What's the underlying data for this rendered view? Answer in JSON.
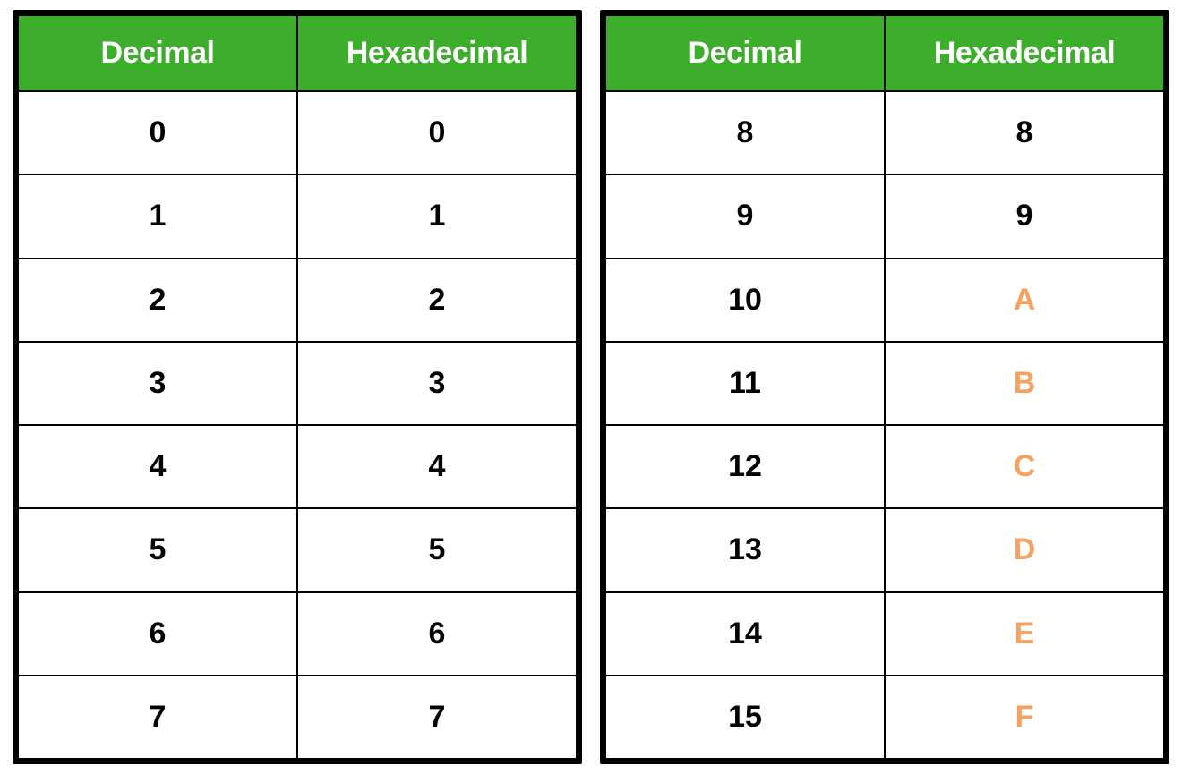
{
  "headers": {
    "decimal": "Decimal",
    "hexadecimal": "Hexadecimal"
  },
  "left_table": {
    "rows": [
      {
        "decimal": "0",
        "hex": "0",
        "highlight": false
      },
      {
        "decimal": "1",
        "hex": "1",
        "highlight": false
      },
      {
        "decimal": "2",
        "hex": "2",
        "highlight": false
      },
      {
        "decimal": "3",
        "hex": "3",
        "highlight": false
      },
      {
        "decimal": "4",
        "hex": "4",
        "highlight": false
      },
      {
        "decimal": "5",
        "hex": "5",
        "highlight": false
      },
      {
        "decimal": "6",
        "hex": "6",
        "highlight": false
      },
      {
        "decimal": "7",
        "hex": "7",
        "highlight": false
      }
    ]
  },
  "right_table": {
    "rows": [
      {
        "decimal": "8",
        "hex": "8",
        "highlight": false
      },
      {
        "decimal": "9",
        "hex": "9",
        "highlight": false
      },
      {
        "decimal": "10",
        "hex": "A",
        "highlight": true
      },
      {
        "decimal": "11",
        "hex": "B",
        "highlight": true
      },
      {
        "decimal": "12",
        "hex": "C",
        "highlight": true
      },
      {
        "decimal": "13",
        "hex": "D",
        "highlight": true
      },
      {
        "decimal": "14",
        "hex": "E",
        "highlight": true
      },
      {
        "decimal": "15",
        "hex": "F",
        "highlight": true
      }
    ]
  },
  "colors": {
    "header_bg": "#3DAE2B",
    "highlight_text": "#F4A261",
    "border": "#000000",
    "text": "#000000"
  }
}
